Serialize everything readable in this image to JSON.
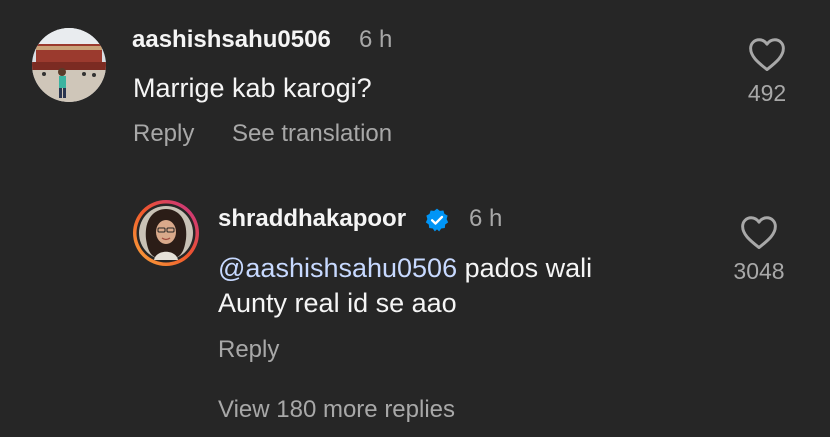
{
  "comments": [
    {
      "username": "aashishsahu0506",
      "time": "6 h",
      "text": "Marrige kab karogi?",
      "likes": "492",
      "reply_label": "Reply",
      "translate_label": "See translation"
    }
  ],
  "reply": {
    "username": "shraddhakapoor",
    "verified": true,
    "time": "6 h",
    "mention": "@aashishsahu0506",
    "text_line1": " pados wali",
    "text_line2": "Aunty real id se aao",
    "likes": "3048",
    "reply_label": "Reply"
  },
  "view_more_label": "View 180 more replies",
  "colors": {
    "background": "#262626",
    "primary_text": "#f5f5f5",
    "secondary_text": "#a8a8a8",
    "verified_blue": "#0095f6"
  }
}
